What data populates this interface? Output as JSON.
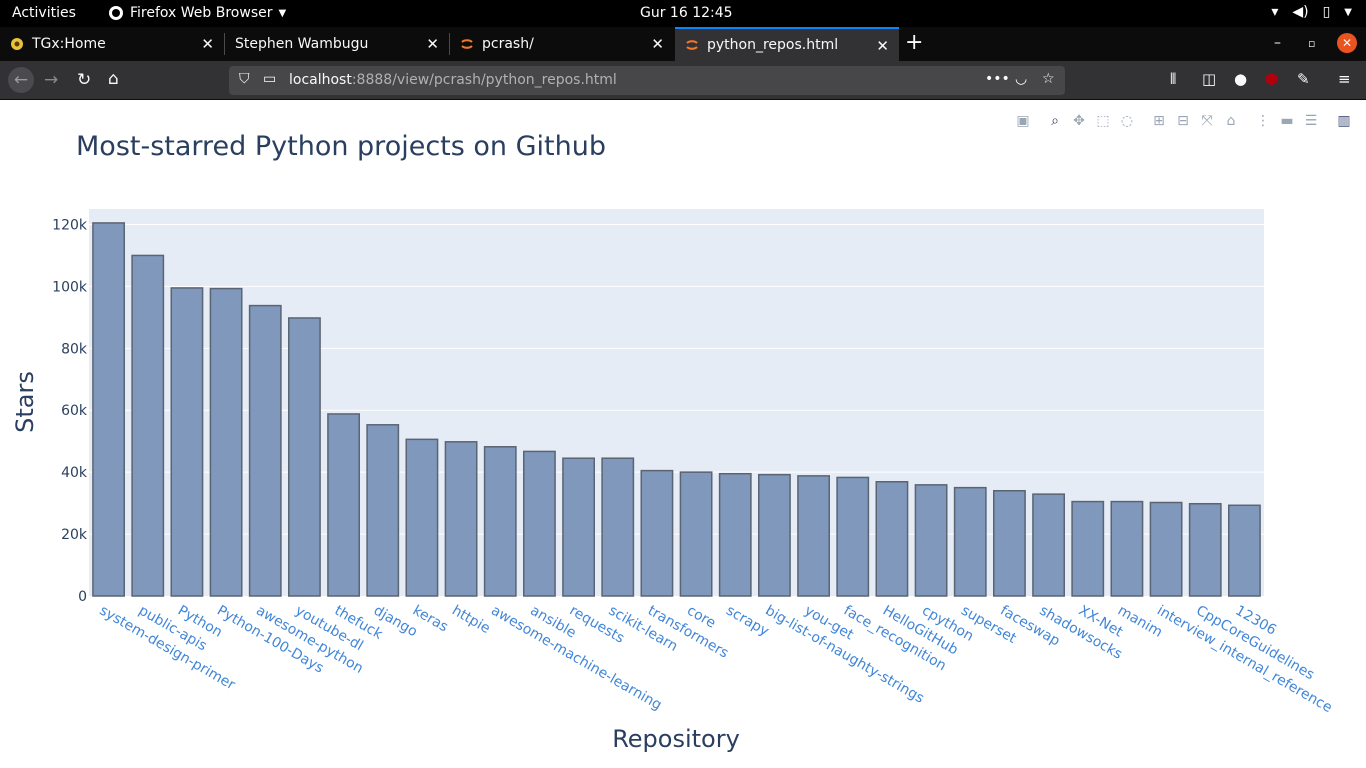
{
  "system": {
    "activities": "Activities",
    "app_name": "Firefox Web Browser",
    "clock": "Gur 16  12:45"
  },
  "tabs": [
    {
      "label": "TGx:Home",
      "close": "✕"
    },
    {
      "label": "Stephen Wambugu",
      "close": "✕"
    },
    {
      "label": "pcrash/",
      "close": "✕"
    },
    {
      "label": "python_repos.html",
      "close": "✕"
    }
  ],
  "urlbar": {
    "host": "localhost",
    "path": ":8888/view/pcrash/python_repos.html"
  },
  "chart_data": {
    "type": "bar",
    "title": "Most-starred Python projects on Github",
    "xlabel": "Repository",
    "ylabel": "Stars",
    "ylim": [
      0,
      125000
    ],
    "yticks": [
      0,
      20000,
      40000,
      60000,
      80000,
      100000,
      120000
    ],
    "ytick_labels": [
      "0",
      "20k",
      "40k",
      "60k",
      "80k",
      "100k",
      "120k"
    ],
    "grid": true,
    "bar_color": "#7f98bc",
    "bar_outline": "#5b6473",
    "plot_bg": "#e5ecf6",
    "categories": [
      "system-design-primer",
      "public-apis",
      "Python",
      "Python-100-Days",
      "awesome-python",
      "youtube-dl",
      "thefuck",
      "django",
      "keras",
      "httpie",
      "awesome-machine-learning",
      "ansible",
      "requests",
      "scikit-learn",
      "transformers",
      "core",
      "scrapy",
      "big-list-of-naughty-strings",
      "you-get",
      "face_recognition",
      "HelloGitHub",
      "cpython",
      "superset",
      "faceswap",
      "shadowsocks",
      "XX-Net",
      "manim",
      "interview_internal_reference",
      "CppCoreGuidelines",
      "12306"
    ],
    "values": [
      120500,
      110000,
      99500,
      99300,
      93800,
      89800,
      58800,
      55300,
      50600,
      49800,
      48200,
      46700,
      44500,
      44500,
      40500,
      40000,
      39500,
      39200,
      38800,
      38300,
      36900,
      35900,
      35000,
      34000,
      32900,
      30500,
      30500,
      30200,
      29800,
      29300
    ]
  }
}
